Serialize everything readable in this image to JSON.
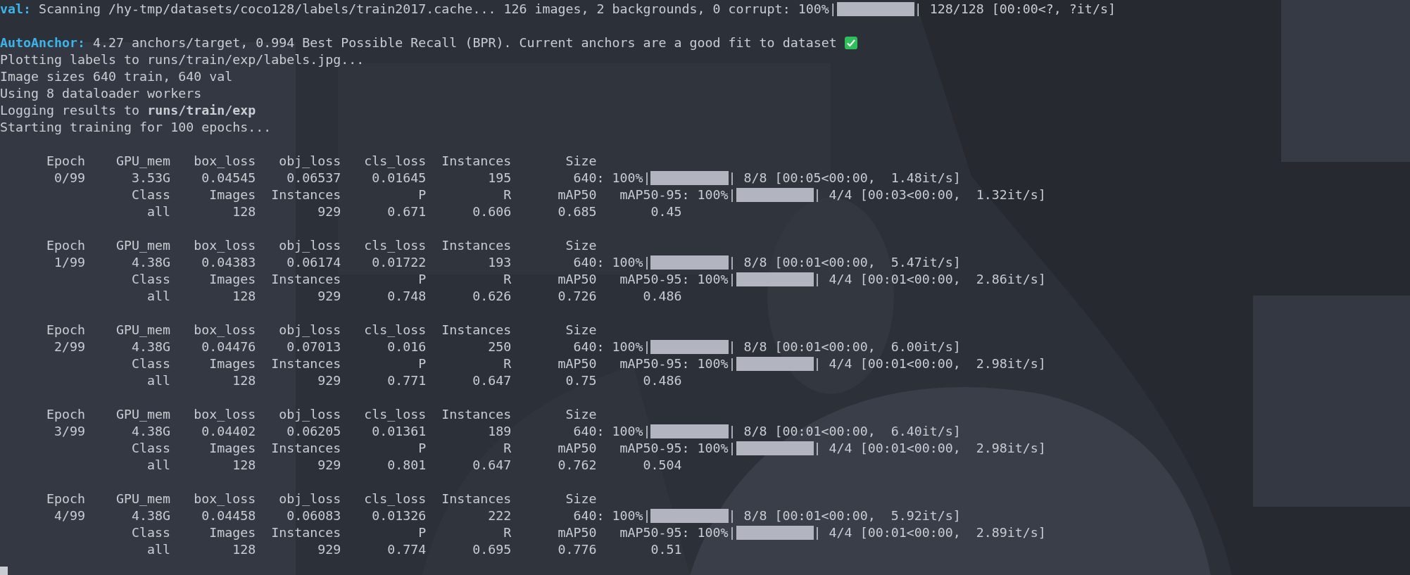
{
  "terminal": {
    "lines": [
      {
        "kind": "scan",
        "label": "val:",
        "text": "Scanning /hy-tmp/datasets/coco128/labels/train2017.cache... 126 images, 2 backgrounds, 0 corrupt: 100%|",
        "level": 1,
        "tail": "| 128/128 [00:00<?, ?it/s]"
      },
      {
        "kind": "blank"
      },
      {
        "kind": "anchor",
        "label": "AutoAnchor:",
        "text": "4.27 anchors/target, 0.994 Best Possible Recall (BPR). Current anchors are a good fit to dataset"
      },
      {
        "kind": "plain",
        "text": "Plotting labels to runs/train/exp/labels.jpg..."
      },
      {
        "kind": "plain",
        "text": "Image sizes 640 train, 640 val"
      },
      {
        "kind": "plain",
        "text": "Using 8 dataloader workers"
      },
      {
        "kind": "plain",
        "text": "Logging results to **runs/train/exp**"
      },
      {
        "kind": "plain",
        "text": "Starting training for 100 epochs..."
      },
      {
        "kind": "blank"
      }
    ],
    "epochs": [
      {
        "train_header": [
          "Epoch",
          "GPU_mem",
          "box_loss",
          "obj_loss",
          "cls_loss",
          "Instances",
          "Size"
        ],
        "train_row": [
          "0/99",
          "3.53G",
          "0.04545",
          "0.06537",
          "0.01645",
          "195",
          "640"
        ],
        "train_progress": {
          "percent": ": 100%|",
          "level": 1,
          "tail": "| 8/8 [00:05<00:00,  1.48it/s]"
        },
        "val_header": [
          "Class",
          "Images",
          "Instances",
          "P",
          "R",
          "mAP50",
          "mAP50-95"
        ],
        "val_progress": {
          "percent": ": 100%|",
          "level": 1,
          "tail": "| 4/4 [00:03<00:00,  1.32it/s]"
        },
        "val_row": [
          "all",
          "128",
          "929",
          "0.671",
          "0.606",
          "0.685",
          "0.45"
        ]
      },
      {
        "train_header": [
          "Epoch",
          "GPU_mem",
          "box_loss",
          "obj_loss",
          "cls_loss",
          "Instances",
          "Size"
        ],
        "train_row": [
          "1/99",
          "4.38G",
          "0.04383",
          "0.06174",
          "0.01722",
          "193",
          "640"
        ],
        "train_progress": {
          "percent": ": 100%|",
          "level": 1,
          "tail": "| 8/8 [00:01<00:00,  5.47it/s]"
        },
        "val_header": [
          "Class",
          "Images",
          "Instances",
          "P",
          "R",
          "mAP50",
          "mAP50-95"
        ],
        "val_progress": {
          "percent": ": 100%|",
          "level": 1,
          "tail": "| 4/4 [00:01<00:00,  2.86it/s]"
        },
        "val_row": [
          "all",
          "128",
          "929",
          "0.748",
          "0.626",
          "0.726",
          "0.486"
        ]
      },
      {
        "train_header": [
          "Epoch",
          "GPU_mem",
          "box_loss",
          "obj_loss",
          "cls_loss",
          "Instances",
          "Size"
        ],
        "train_row": [
          "2/99",
          "4.38G",
          "0.04476",
          "0.07013",
          "0.016",
          "250",
          "640"
        ],
        "train_progress": {
          "percent": ": 100%|",
          "level": 1,
          "tail": "| 8/8 [00:01<00:00,  6.00it/s]"
        },
        "val_header": [
          "Class",
          "Images",
          "Instances",
          "P",
          "R",
          "mAP50",
          "mAP50-95"
        ],
        "val_progress": {
          "percent": ": 100%|",
          "level": 1,
          "tail": "| 4/4 [00:01<00:00,  2.98it/s]"
        },
        "val_row": [
          "all",
          "128",
          "929",
          "0.771",
          "0.647",
          "0.75",
          "0.486"
        ]
      },
      {
        "train_header": [
          "Epoch",
          "GPU_mem",
          "box_loss",
          "obj_loss",
          "cls_loss",
          "Instances",
          "Size"
        ],
        "train_row": [
          "3/99",
          "4.38G",
          "0.04402",
          "0.06205",
          "0.01361",
          "189",
          "640"
        ],
        "train_progress": {
          "percent": ": 100%|",
          "level": 1,
          "tail": "| 8/8 [00:01<00:00,  6.40it/s]"
        },
        "val_header": [
          "Class",
          "Images",
          "Instances",
          "P",
          "R",
          "mAP50",
          "mAP50-95"
        ],
        "val_progress": {
          "percent": ": 100%|",
          "level": 1,
          "tail": "| 4/4 [00:01<00:00,  2.98it/s]"
        },
        "val_row": [
          "all",
          "128",
          "929",
          "0.801",
          "0.647",
          "0.762",
          "0.504"
        ]
      },
      {
        "train_header": [
          "Epoch",
          "GPU_mem",
          "box_loss",
          "obj_loss",
          "cls_loss",
          "Instances",
          "Size"
        ],
        "train_row": [
          "4/99",
          "4.38G",
          "0.04458",
          "0.06083",
          "0.01326",
          "222",
          "640"
        ],
        "train_progress": {
          "percent": ": 100%|",
          "level": 1,
          "tail": "| 8/8 [00:01<00:00,  5.92it/s]"
        },
        "val_header": [
          "Class",
          "Images",
          "Instances",
          "P",
          "R",
          "mAP50",
          "mAP50-95"
        ],
        "val_progress": {
          "percent": ": 100%|",
          "level": 1,
          "tail": "| 4/4 [00:01<00:00,  2.89it/s]"
        },
        "val_row": [
          "all",
          "128",
          "929",
          "0.774",
          "0.695",
          "0.776",
          "0.51"
        ]
      }
    ]
  }
}
